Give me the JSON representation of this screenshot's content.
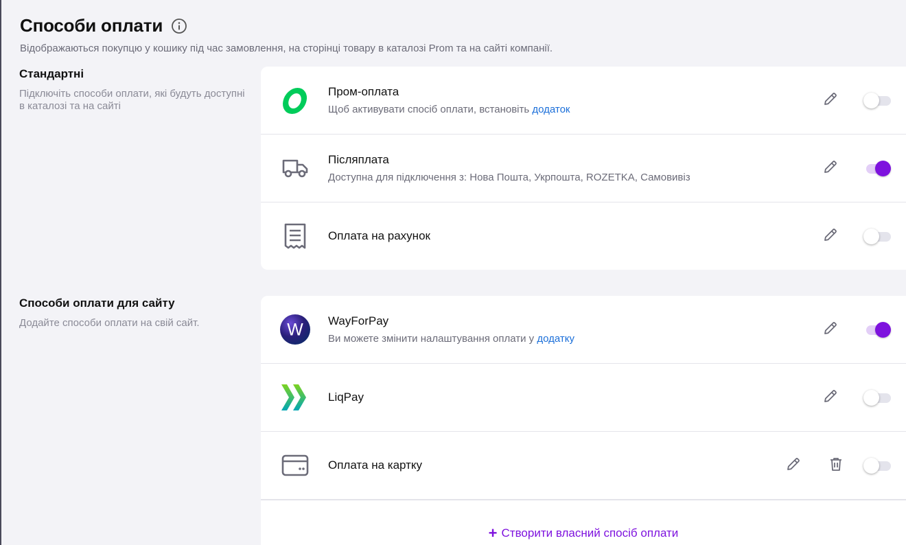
{
  "header": {
    "title": "Способи оплати",
    "subtitle": "Відображаються покупцю у кошику під час замовлення, на сторінці товару в каталозі Prom та на сайті компанії."
  },
  "standard": {
    "title": "Стандартні",
    "description": "Підключіть способи оплати, які будуть доступні в каталозі та на сайті",
    "items": [
      {
        "name": "Пром-оплата",
        "desc_text": "Щоб активувати спосіб оплати, встановіть ",
        "desc_link": "додаток",
        "icon": "prom-logo-icon",
        "enabled": false
      },
      {
        "name": "Післяплата",
        "desc_text": "Доступна для підключення з: Нова Пошта, Укрпошта, ROZETKA, Самовивіз",
        "icon": "truck-icon",
        "enabled": true
      },
      {
        "name": "Оплата на рахунок",
        "icon": "receipt-icon",
        "enabled": false
      }
    ]
  },
  "site": {
    "title": "Способи оплати для сайту",
    "description": "Додайте способи оплати на свій сайт.",
    "items": [
      {
        "name": "WayForPay",
        "desc_text": "Ви можете змінити налаштування оплати у ",
        "desc_link": "додатку",
        "icon": "wayforpay-logo-icon",
        "logo_letter": "W",
        "enabled": true
      },
      {
        "name": "LiqPay",
        "icon": "liqpay-logo-icon",
        "enabled": false
      },
      {
        "name": "Оплата на картку",
        "icon": "card-icon",
        "enabled": false
      }
    ],
    "create_label": "Створити власний спосіб оплати"
  },
  "colors": {
    "accent": "#7e12de",
    "link": "#1b6fd9",
    "prom_green": "#00cc5a"
  }
}
